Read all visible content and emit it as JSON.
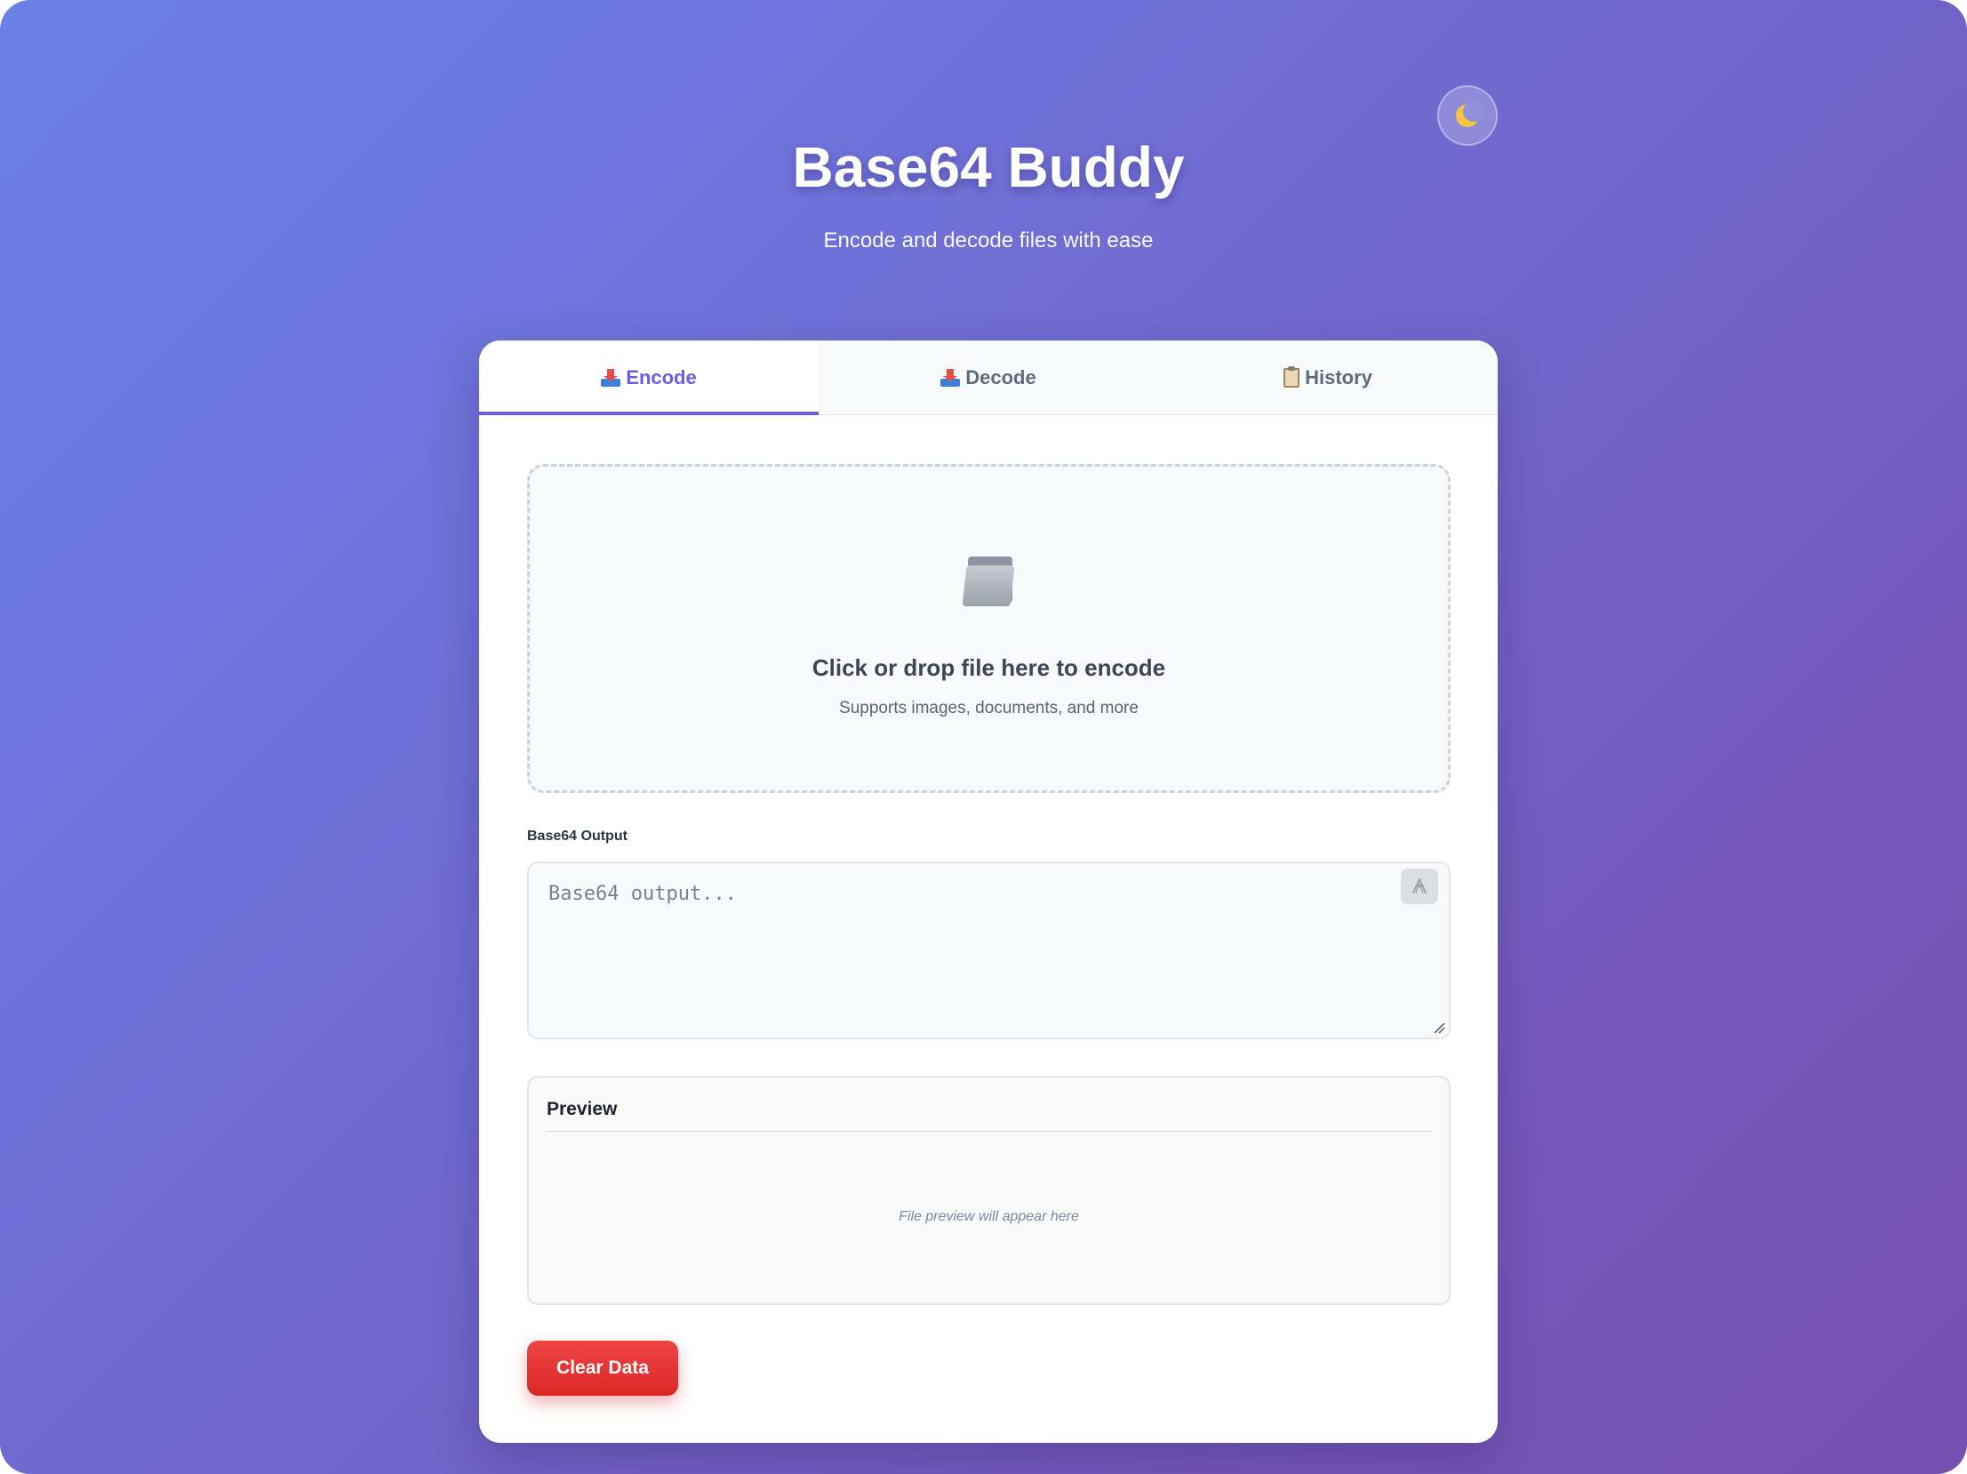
{
  "app": {
    "title": "Base64 Buddy",
    "subtitle": "Encode and decode files with ease"
  },
  "theme_toggle": {
    "icon": "moon-icon"
  },
  "tabs": [
    {
      "label": "Encode",
      "icon": "inbox-tray-icon",
      "active": true
    },
    {
      "label": "Decode",
      "icon": "inbox-tray-icon",
      "active": false
    },
    {
      "label": "History",
      "icon": "clipboard-icon",
      "active": false
    }
  ],
  "dropzone": {
    "icon": "folder-icon",
    "title": "Click or drop file here to encode",
    "subtitle": "Supports images, documents, and more"
  },
  "output": {
    "label": "Base64 Output",
    "placeholder": "Base64 output...",
    "value": ""
  },
  "preview": {
    "title": "Preview",
    "empty_text": "File preview will appear here"
  },
  "actions": {
    "clear_label": "Clear Data"
  },
  "colors": {
    "accent": "#6b5ce0",
    "danger": "#dc2626",
    "gradient_start": "#6a80e6",
    "gradient_end": "#7652b0"
  }
}
